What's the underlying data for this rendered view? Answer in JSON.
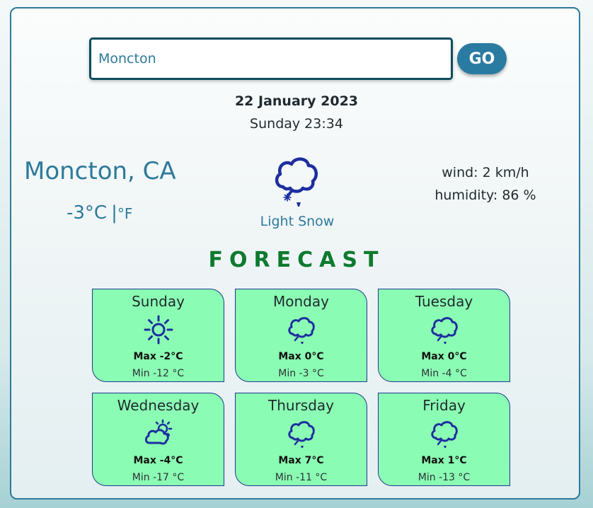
{
  "search": {
    "value": "Moncton",
    "button_label": "GO"
  },
  "date": {
    "full": "22 January 2023",
    "day_time": "Sunday 23:34"
  },
  "current": {
    "city": "Moncton, CA",
    "temperature": "-3°C",
    "unit_separator": "|",
    "unit_alt": "°F",
    "condition": "Light Snow",
    "icon": "snow-cloud-icon",
    "wind": "wind: 2 km/h",
    "humidity": "humidity: 86 %"
  },
  "forecast": {
    "title": "FORECAST",
    "days": [
      {
        "day": "Sunday",
        "icon": "sun-icon",
        "max": "Max -2°C",
        "min": "Min -12 °C"
      },
      {
        "day": "Monday",
        "icon": "snow-cloud-icon",
        "max": "Max 0°C",
        "min": "Min -3 °C"
      },
      {
        "day": "Tuesday",
        "icon": "snow-cloud-icon",
        "max": "Max 0°C",
        "min": "Min -4 °C"
      },
      {
        "day": "Wednesday",
        "icon": "partly-cloudy-icon",
        "max": "Max -4°C",
        "min": "Min -17 °C"
      },
      {
        "day": "Thursday",
        "icon": "snow-cloud-icon",
        "max": "Max 7°C",
        "min": "Min -11 °C"
      },
      {
        "day": "Friday",
        "icon": "snow-cloud-icon",
        "max": "Max 1°C",
        "min": "Min -13 °C"
      }
    ]
  },
  "colors": {
    "accent": "#2d7a9a",
    "button": "#2a7ba1",
    "forecast_title": "#0e7a2f",
    "card_bg": "#8bfcb3",
    "icon_stroke": "#1e2ea0"
  }
}
